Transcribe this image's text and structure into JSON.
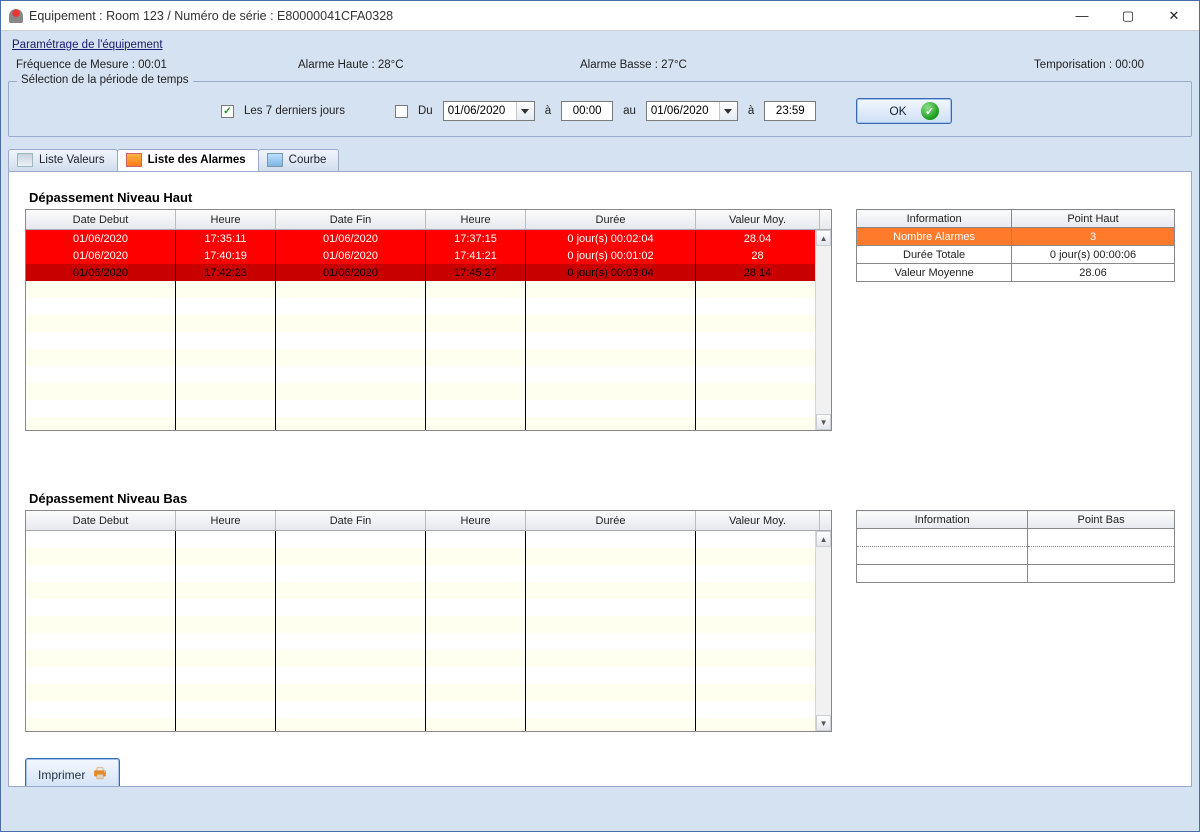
{
  "window": {
    "title": "Equipement : Room 123 / Numéro de série : E80000041CFA0328"
  },
  "params": {
    "link": "Paramétrage de l'équipement",
    "freq": "Fréquence de Mesure : 00:01",
    "alarme_haute": "Alarme Haute : 28°C",
    "alarme_basse": "Alarme Basse : 27°C",
    "tempo": "Temporisation : 00:00"
  },
  "period": {
    "legend": "Sélection de la période de temps",
    "last7_label": "Les 7 derniers jours",
    "last7_checked": true,
    "du_label": "Du",
    "from_date": "01/06/2020",
    "a_label": "à",
    "from_time": "00:00",
    "au_label": "au",
    "to_date": "01/06/2020",
    "to_time": "23:59",
    "ok_label": "OK"
  },
  "tabs": {
    "valeurs": "Liste Valeurs",
    "alarmes": "Liste des Alarmes",
    "courbe": "Courbe"
  },
  "haut": {
    "title": "Dépassement Niveau Haut",
    "headers": [
      "Date Debut",
      "Heure",
      "Date Fin",
      "Heure",
      "Durée",
      "Valeur Moy."
    ],
    "rows": [
      [
        "01/06/2020",
        "17:35:11",
        "01/06/2020",
        "17:37:15",
        "0 jour(s) 00:02:04",
        "28.04"
      ],
      [
        "01/06/2020",
        "17:40:19",
        "01/06/2020",
        "17:41:21",
        "0 jour(s) 00:01:02",
        "28"
      ],
      [
        "01/06/2020",
        "17:42:23",
        "01/06/2020",
        "17:45:27",
        "0 jour(s) 00:03:04",
        "28.14"
      ]
    ],
    "summary_headers": [
      "Information",
      "Point Haut"
    ],
    "summary_rows": [
      [
        "Nombre Alarmes",
        "3"
      ],
      [
        "Durée Totale",
        "0 jour(s) 00:00:06"
      ],
      [
        "Valeur Moyenne",
        "28.06"
      ]
    ]
  },
  "bas": {
    "title": "Dépassement Niveau Bas",
    "headers": [
      "Date Debut",
      "Heure",
      "Date Fin",
      "Heure",
      "Durée",
      "Valeur Moy."
    ],
    "summary_headers": [
      "Information",
      "Point Bas"
    ]
  },
  "print": {
    "label": "Imprimer"
  }
}
